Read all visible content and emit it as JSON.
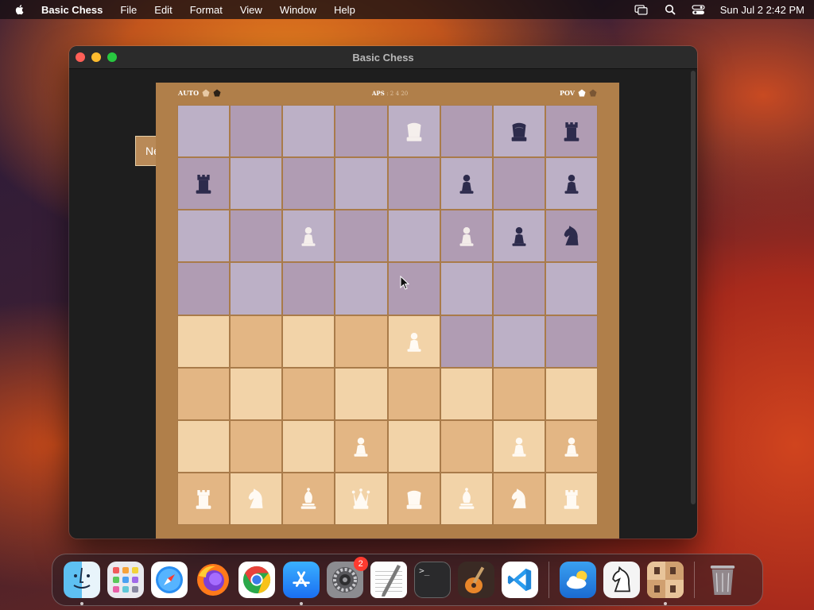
{
  "menubar": {
    "app_name": "Basic Chess",
    "items": [
      "File",
      "Edit",
      "Format",
      "View",
      "Window",
      "Help"
    ],
    "datetime": "Sun Jul 2  2:42 PM"
  },
  "window": {
    "title": "Basic Chess",
    "new_game_label": "New Game"
  },
  "board_header": {
    "left_label": "AUTO",
    "mid_label": "APS",
    "mid_values": [
      ": 2",
      "4 20"
    ],
    "right_label": "POV"
  },
  "colors": {
    "light_square": "#f2d3a8",
    "dark_square": "#e3b684",
    "light_square_tinted": "#bcb0c6",
    "dark_square_tinted": "#b09cb3",
    "white_piece": "#fffaf3",
    "black_piece": "#2d2b4c",
    "frame": "#b07f4a"
  },
  "board": [
    [
      {
        "t": "t"
      },
      {
        "t": "t"
      },
      {
        "t": "t"
      },
      {
        "t": "t"
      },
      {
        "t": "t",
        "p": "wK"
      },
      {
        "t": "t"
      },
      {
        "t": "t",
        "p": "bK"
      },
      {
        "t": "t",
        "p": "bR"
      }
    ],
    [
      {
        "t": "t",
        "p": "bR"
      },
      {
        "t": "t"
      },
      {
        "t": "t"
      },
      {
        "t": "t"
      },
      {
        "t": "t"
      },
      {
        "t": "t",
        "p": "bP"
      },
      {
        "t": "t"
      },
      {
        "t": "t",
        "p": "bP"
      }
    ],
    [
      {
        "t": "t"
      },
      {
        "t": "t"
      },
      {
        "t": "t",
        "p": "wP"
      },
      {
        "t": "t"
      },
      {
        "t": "t"
      },
      {
        "t": "t",
        "p": "wP"
      },
      {
        "t": "t",
        "p": "bP"
      },
      {
        "t": "t",
        "p": "bN"
      }
    ],
    [
      {
        "t": "t"
      },
      {
        "t": "t"
      },
      {
        "t": "t"
      },
      {
        "t": "t"
      },
      {
        "t": "t"
      },
      {
        "t": "t"
      },
      {
        "t": "t"
      },
      {
        "t": "t"
      }
    ],
    [
      {
        "t": "n"
      },
      {
        "t": "n"
      },
      {
        "t": "n"
      },
      {
        "t": "n"
      },
      {
        "t": "n",
        "p": "wP"
      },
      {
        "t": "t"
      },
      {
        "t": "t"
      },
      {
        "t": "t"
      }
    ],
    [
      {
        "t": "n"
      },
      {
        "t": "n"
      },
      {
        "t": "n"
      },
      {
        "t": "n"
      },
      {
        "t": "n"
      },
      {
        "t": "n"
      },
      {
        "t": "n"
      },
      {
        "t": "n"
      }
    ],
    [
      {
        "t": "n"
      },
      {
        "t": "n"
      },
      {
        "t": "n"
      },
      {
        "t": "n",
        "p": "wP"
      },
      {
        "t": "n"
      },
      {
        "t": "n"
      },
      {
        "t": "n",
        "p": "wP"
      },
      {
        "t": "n",
        "p": "wP"
      }
    ],
    [
      {
        "t": "n",
        "p": "wR"
      },
      {
        "t": "n",
        "p": "wN"
      },
      {
        "t": "n",
        "p": "wB"
      },
      {
        "t": "n",
        "p": "wQ"
      },
      {
        "t": "n",
        "p": "wK"
      },
      {
        "t": "n",
        "p": "wB"
      },
      {
        "t": "n",
        "p": "wN"
      },
      {
        "t": "n",
        "p": "wR"
      }
    ]
  ],
  "dock": {
    "apps": [
      {
        "name": "finder",
        "running": true
      },
      {
        "name": "launchpad",
        "running": false
      },
      {
        "name": "safari",
        "running": false
      },
      {
        "name": "firefox",
        "running": false
      },
      {
        "name": "chrome",
        "running": false
      },
      {
        "name": "app-store",
        "running": true
      },
      {
        "name": "system-settings",
        "running": false,
        "badge": "2"
      },
      {
        "name": "textedit",
        "running": false
      },
      {
        "name": "terminal",
        "running": false
      },
      {
        "name": "garageband",
        "running": false
      },
      {
        "name": "vscode",
        "running": false
      },
      {
        "sep": true
      },
      {
        "name": "weather",
        "running": false
      },
      {
        "name": "chess",
        "running": false
      },
      {
        "name": "basic-chess",
        "running": true
      },
      {
        "sep": true
      },
      {
        "name": "trash",
        "running": false
      }
    ]
  }
}
